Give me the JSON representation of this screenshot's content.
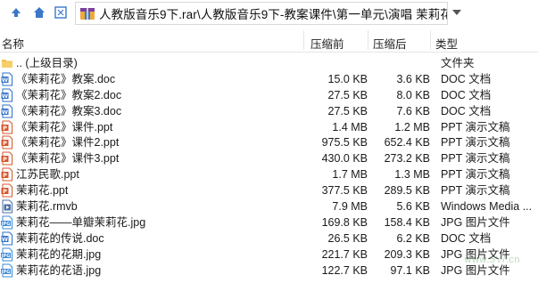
{
  "toolbar": {
    "path": "人教版音乐9下.rar\\人教版音乐9下-教案课件\\第一单元\\演唱 茉莉花 - 解"
  },
  "columns": {
    "name": "名称",
    "packed": "压缩前",
    "size": "压缩后",
    "type": "类型"
  },
  "rows": [
    {
      "name": ".. (上级目录)",
      "packed": "",
      "size": "",
      "type": "文件夹",
      "icon": "folder-icon"
    },
    {
      "name": "《茉莉花》教案.doc",
      "packed": "15.0 KB",
      "size": "3.6 KB",
      "type": "DOC 文档",
      "icon": "doc-icon"
    },
    {
      "name": "《茉莉花》教案2.doc",
      "packed": "27.5 KB",
      "size": "8.0 KB",
      "type": "DOC 文档",
      "icon": "doc-icon"
    },
    {
      "name": "《茉莉花》教案3.doc",
      "packed": "27.5 KB",
      "size": "7.6 KB",
      "type": "DOC 文档",
      "icon": "doc-icon"
    },
    {
      "name": "《茉莉花》课件.ppt",
      "packed": "1.4 MB",
      "size": "1.2 MB",
      "type": "PPT 演示文稿",
      "icon": "ppt-icon"
    },
    {
      "name": "《茉莉花》课件2.ppt",
      "packed": "975.5 KB",
      "size": "652.4 KB",
      "type": "PPT 演示文稿",
      "icon": "ppt-icon"
    },
    {
      "name": "《茉莉花》课件3.ppt",
      "packed": "430.0 KB",
      "size": "273.2 KB",
      "type": "PPT 演示文稿",
      "icon": "ppt-icon"
    },
    {
      "name": "江苏民歌.ppt",
      "packed": "1.7 MB",
      "size": "1.3 MB",
      "type": "PPT 演示文稿",
      "icon": "ppt-icon"
    },
    {
      "name": "茉莉花.ppt",
      "packed": "377.5 KB",
      "size": "289.5 KB",
      "type": "PPT 演示文稿",
      "icon": "ppt-icon"
    },
    {
      "name": "茉莉花.rmvb",
      "packed": "7.9 MB",
      "size": "5.6 KB",
      "type": "Windows Media ...",
      "icon": "video-icon"
    },
    {
      "name": "茉莉花——单瓣茉莉花.jpg",
      "packed": "169.8 KB",
      "size": "158.4 KB",
      "type": "JPG 图片文件",
      "icon": "jpg-icon"
    },
    {
      "name": "茉莉花的传说.doc",
      "packed": "26.5 KB",
      "size": "6.2 KB",
      "type": "DOC 文档",
      "icon": "doc-icon"
    },
    {
      "name": "茉莉花的花期.jpg",
      "packed": "221.7 KB",
      "size": "209.3 KB",
      "type": "JPG 图片文件",
      "icon": "jpg-icon"
    },
    {
      "name": "茉莉花的花语.jpg",
      "packed": "122.7 KB",
      "size": "97.1 KB",
      "type": "JPG 图片文件",
      "icon": "jpg-icon"
    }
  ],
  "watermark": "www.5Y/.cn",
  "colors": {
    "folder": "#f2c14e",
    "doc": "#2b6fc9",
    "ppt": "#d9552b",
    "jpg": "#3a8ad6",
    "video": "#4a6fa5",
    "nav": "#3a78c8"
  }
}
